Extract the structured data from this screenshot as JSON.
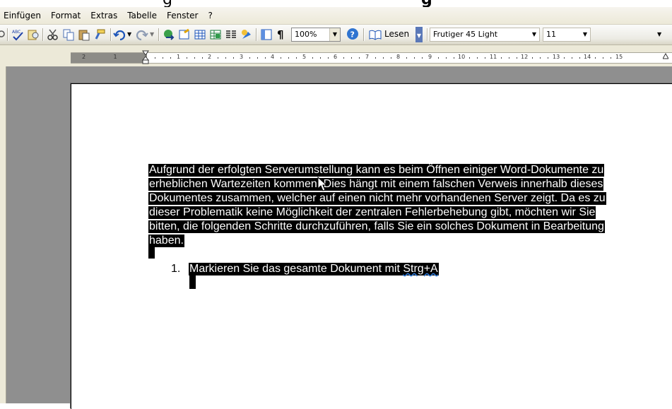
{
  "menu": {
    "einfuegen": "Einfügen",
    "format": "Format",
    "extras": "Extras",
    "tabelle": "Tabelle",
    "fenster": "Fenster",
    "help": "?"
  },
  "toolbar": {
    "zoom_value": "100%",
    "read_label": "Lesen",
    "font_value": "Frutiger 45 Light",
    "size_value": "11",
    "paragraph_glyph": "¶"
  },
  "document": {
    "lines": [
      "Aufgrund der erfolgten Serverumstellung kann es beim Öffnen einiger Word-Dokumente zu",
      "erheblichen Wartezeiten kommen. Dies hängt mit einem falschen Verweis innerhalb dieses",
      "Dokumentes zusammen, welcher auf einen nicht mehr vorhandenen Server zeigt. Da es zu",
      "dieser Problematik keine Möglichkeit der zentralen Fehlerbehebung gibt, möchten wir Sie",
      "bitten, die folgenden Schritte durchzuführen, falls Sie ein solches Dokument in Bearbeitung",
      "haben."
    ],
    "list": {
      "number": "1.",
      "text": "Markieren Sie das gesamte Dokument mit ",
      "shortcut": "Strg+A"
    }
  },
  "ruler": {
    "left_numbers": [
      "2",
      "1"
    ],
    "numbers": [
      "1",
      "2",
      "3",
      "4",
      "5",
      "6",
      "7",
      "8",
      "9",
      "10",
      "11",
      "12",
      "13",
      "14",
      "15"
    ]
  },
  "colors": {
    "selection": "#000000",
    "selection_text": "#ffffff",
    "workspace": "#8f8f8f",
    "chrome": "#ece9d8"
  }
}
